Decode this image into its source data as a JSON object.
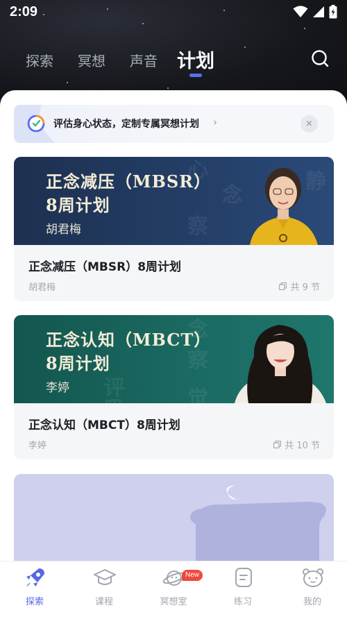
{
  "status_bar": {
    "time": "2:09"
  },
  "tabs": [
    {
      "label": "探索",
      "active": false
    },
    {
      "label": "冥想",
      "active": false
    },
    {
      "label": "声音",
      "active": false
    },
    {
      "label": "计划",
      "active": true
    }
  ],
  "banner": {
    "text": "评估身心状态，定制专属冥想计划",
    "chevron": "›",
    "close": "×"
  },
  "cards": [
    {
      "title": "正念减压（MBSR）8周计划",
      "author": "胡君梅",
      "count": "共 9 节",
      "hero_title": "正念减压（MBSR）",
      "hero_subtitle": "8周计划",
      "hero_author": "胡君梅",
      "color": "#1f3354"
    },
    {
      "title": "正念认知（MBCT）8周计划",
      "author": "李婷",
      "count": "共 10 节",
      "hero_title": "正念认知（MBCT）",
      "hero_subtitle": "8周计划",
      "hero_author": "李婷",
      "color": "#175b56"
    }
  ],
  "bottom_nav": [
    {
      "label": "探索",
      "icon": "rocket-icon",
      "active": true
    },
    {
      "label": "课程",
      "icon": "graduation-cap-icon",
      "active": false
    },
    {
      "label": "冥想室",
      "icon": "planet-icon",
      "active": false,
      "badge": "New"
    },
    {
      "label": "练习",
      "icon": "note-icon",
      "active": false
    },
    {
      "label": "我的",
      "icon": "bear-face-icon",
      "active": false
    }
  ],
  "colors": {
    "accent": "#5468e8",
    "badge": "#f0483e"
  }
}
